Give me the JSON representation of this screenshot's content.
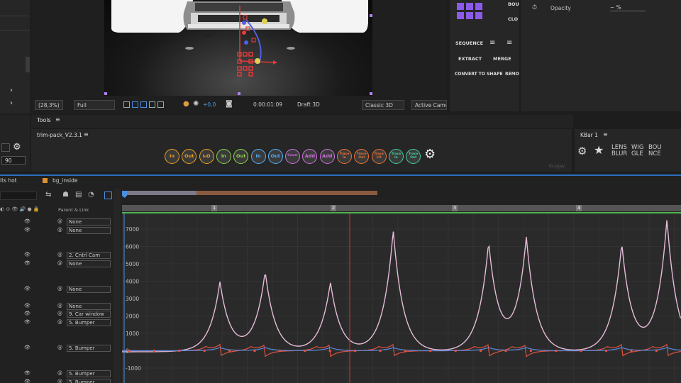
{
  "viewer": {
    "zoom": "(28,3%)",
    "resolution": "Full",
    "timecode": "0:00:01:09",
    "exposure": "+0,0",
    "draft": "Draft 3D",
    "renderer": "Classic 3D",
    "camera": "Active Came"
  },
  "tools": {
    "title": "Tools"
  },
  "trimpack": {
    "title": "trim-pack_V2.3.1",
    "buttons": [
      {
        "name": "in",
        "label": "In",
        "color": "#f0a020"
      },
      {
        "name": "out",
        "label": "Out",
        "color": "#f0a020"
      },
      {
        "name": "in-out",
        "label": "I₀O",
        "color": "#f0a020"
      },
      {
        "name": "in-2",
        "label": "In",
        "color": "#8ad34a"
      },
      {
        "name": "out-2",
        "label": "Out",
        "color": "#8ad34a"
      },
      {
        "name": "in-3",
        "label": "In",
        "color": "#4fb3ff"
      },
      {
        "name": "out-3",
        "label": "Out",
        "color": "#4fb3ff"
      },
      {
        "name": "cover",
        "label": "Cover",
        "color": "#d070e0"
      },
      {
        "name": "add",
        "label": "Add",
        "color": "#d070e0"
      },
      {
        "name": "add-2",
        "label": "Add",
        "color": "#d070e0"
      },
      {
        "name": "trace-in",
        "label": "Trace In",
        "color": "#f07030"
      },
      {
        "name": "trace-out",
        "label": "Trace Out",
        "color": "#f07030"
      },
      {
        "name": "trace-io",
        "label": "Trace I/O",
        "color": "#f07030"
      },
      {
        "name": "trace-in-2",
        "label": "Trace In",
        "color": "#40d0a0"
      },
      {
        "name": "trace-out-2",
        "label": "Trace Out",
        "color": "#40d0a0"
      }
    ],
    "watermark": "KLagay"
  },
  "kbar": {
    "title": "KBar 1",
    "lens": "LENS BLUR",
    "wiggle": "WIG GLE",
    "bounce": "BOU NCE"
  },
  "right_panel": {
    "bou": "BOU",
    "clo": "CLO",
    "sequence": "SEQUENCE",
    "extract": "EXTRACT",
    "merge": "MERGE",
    "convert": "CONVERT TO SHAPE",
    "remo": "REMO",
    "opacity": "Opacity",
    "opacity_value": "~ %"
  },
  "left": {
    "value_90": "90"
  },
  "timeline": {
    "tabs": [
      "its hot",
      "bg_inside"
    ],
    "parent_header": "Parent & Link",
    "layers": [
      {
        "parent": "None"
      },
      {
        "parent": "None"
      },
      {
        "parent": "2. Cntrl Cam"
      },
      {
        "parent": "None"
      },
      {
        "parent": "None"
      },
      {
        "parent": "None"
      },
      {
        "parent": "9. Car window"
      },
      {
        "parent": "5. Bumper"
      },
      {
        "parent": "5. Bumper"
      },
      {
        "parent": "5. Bumper"
      },
      {
        "parent": "5. Bumper"
      }
    ],
    "ruler": [
      ":00f",
      "05f",
      "10f",
      "15f",
      "20f",
      "25f",
      "01:00f",
      "05f",
      "10f",
      "15f",
      "20f",
      "25f",
      "02:00f",
      "05f",
      "10f",
      "15f",
      "20f",
      "25f",
      "03:00f",
      "05f",
      "10f",
      "15f",
      "20f"
    ],
    "markers": [
      "1",
      "2",
      "3",
      "4"
    ]
  },
  "chart_data": {
    "type": "line",
    "title": "",
    "xlabel": "",
    "ylabel": "",
    "ylim": [
      -1000,
      7000
    ],
    "yticks": [
      7000,
      6000,
      5000,
      4000,
      3000,
      2000,
      1000,
      0,
      -1000
    ],
    "peaks": [
      {
        "x": 3.9,
        "y": 4000
      },
      {
        "x": 5.7,
        "y": 4600
      },
      {
        "x": 8.3,
        "y": 4000
      },
      {
        "x": 10.8,
        "y": 7000
      },
      {
        "x": 14.6,
        "y": 6200
      },
      {
        "x": 16.1,
        "y": 6500
      },
      {
        "x": 19.9,
        "y": 6200
      },
      {
        "x": 21.7,
        "y": 7600
      }
    ],
    "series": [
      {
        "name": "",
        "color": "#e6bcd8"
      },
      {
        "name": "",
        "color": "#e0523f"
      },
      {
        "name": "",
        "color": "#5a8ae0"
      }
    ]
  }
}
